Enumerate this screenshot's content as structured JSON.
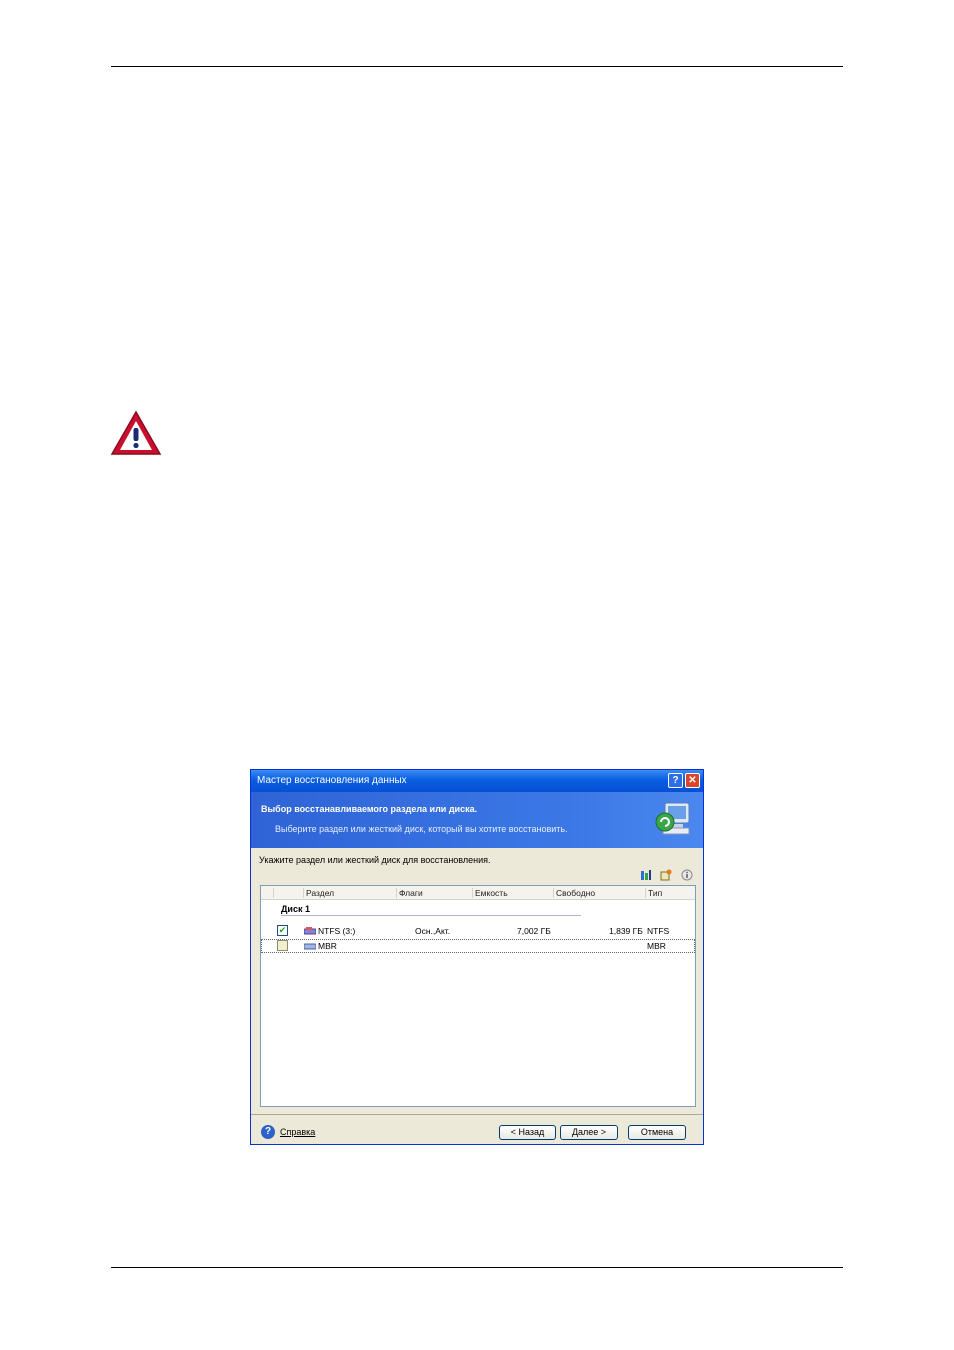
{
  "dialog": {
    "title": "Мастер восстановления данных",
    "help_glyph": "?",
    "close_glyph": "✕",
    "heading": "Выбор восстанавливаемого раздела или диска.",
    "subheading": "Выберите раздел или жесткий диск, который вы хотите восстановить.",
    "instruction": "Укажите раздел или жесткий диск для восстановления.",
    "toolbar_icons": [
      "columns-icon",
      "properties-icon",
      "info-icon"
    ]
  },
  "table": {
    "columns": [
      "Раздел",
      "Флаги",
      "Емкость",
      "Свободно",
      "Тип"
    ],
    "group": "Диск 1",
    "rows": [
      {
        "checked": true,
        "partition": "NTFS (3:)",
        "flags": "Осн.,Акт.",
        "capacity": "7,002 ГБ",
        "free": "1,839 ГБ",
        "type": "NTFS"
      },
      {
        "checked": false,
        "partition": "MBR",
        "flags": "",
        "capacity": "",
        "free": "",
        "type": "MBR"
      }
    ]
  },
  "footer": {
    "help": "Справка",
    "back": "< Назад",
    "next": "Далее >",
    "cancel": "Отмена"
  },
  "colors": {
    "titlebar": "#0a5ee0",
    "banner": "#3b78e6",
    "dialog_bg": "#ece9d8",
    "warning_red": "#c8102e"
  }
}
